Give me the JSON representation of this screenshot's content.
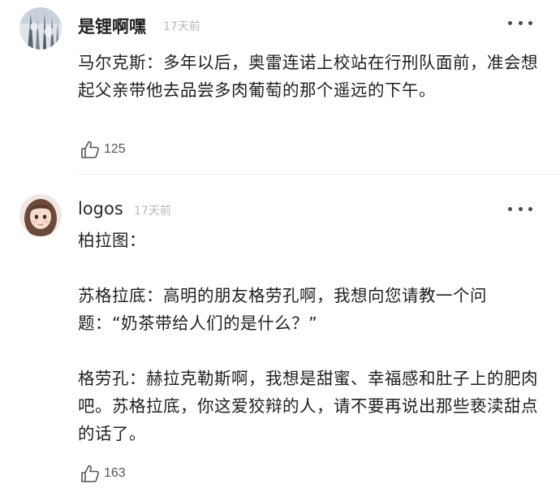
{
  "comments": [
    {
      "username": "是锂啊嘿",
      "time": "17天前",
      "paragraphs": [
        "马尔克斯：多年以后，奥雷连诺上校站在行刑队面前，准会想起父亲带他去品尝多肉葡萄的那个遥远的下午。"
      ],
      "likes": "125"
    },
    {
      "username": "logos",
      "time": "17天前",
      "paragraphs": [
        "柏拉图：",
        "",
        "苏格拉底：高明的朋友格劳孔啊，我想向您请教一个问题：“奶茶带给人们的是什么？”",
        "",
        "格劳孔：赫拉克勒斯啊，我想是甜蜜、幸福感和肚子上的肥肉吧。苏格拉底，你这爱狡辩的人，请不要再说出那些亵渎甜点的话了。"
      ],
      "likes": "163"
    }
  ],
  "icons": {
    "like": "thumbs-up-icon",
    "more": "more-dots-icon"
  },
  "colors": {
    "text": "#1f1f1f",
    "username": "#222222",
    "timestamp": "#b8b8b8",
    "icon": "#555555"
  }
}
